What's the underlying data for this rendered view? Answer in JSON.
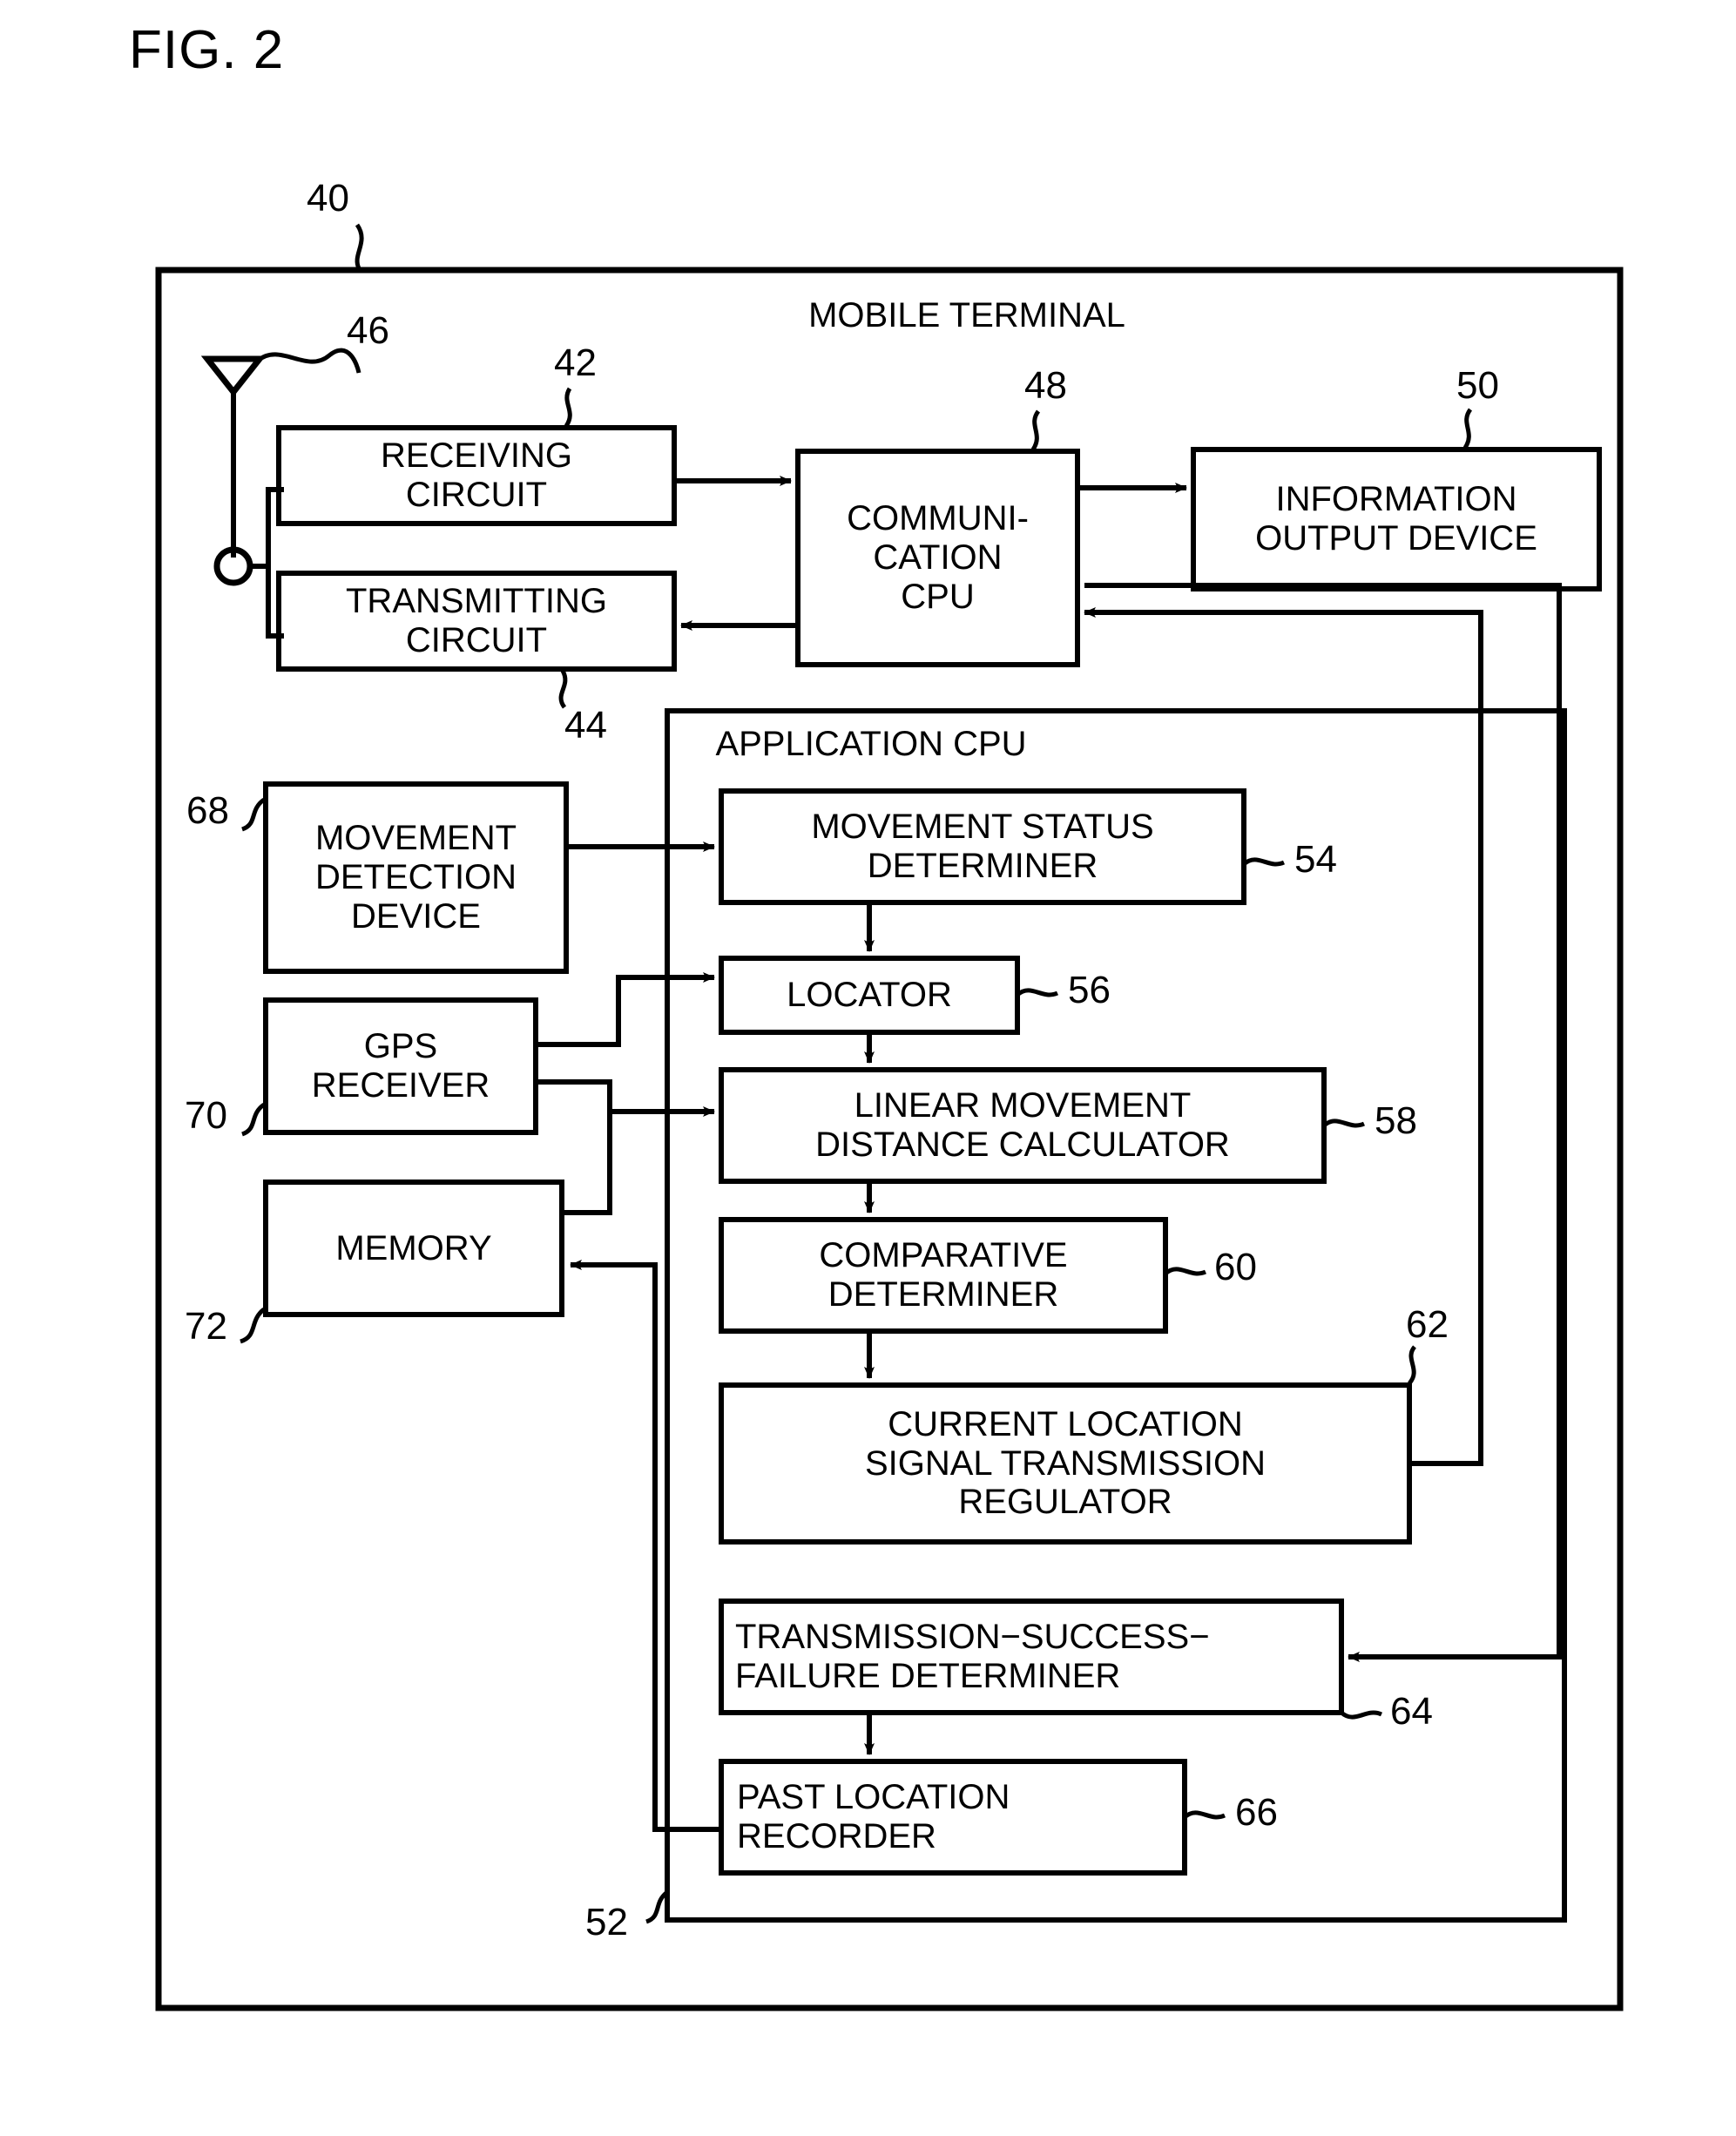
{
  "figure": {
    "title": "FIG. 2",
    "outer_group_title": "MOBILE TERMINAL",
    "outer_group_ref": "40",
    "inner_group_title": "APPLICATION CPU",
    "inner_group_ref": "52",
    "antenna_ref": "46"
  },
  "blocks": {
    "receiving_circuit": {
      "label": "RECEIVING\nCIRCUIT",
      "ref": "42"
    },
    "transmitting_circuit": {
      "label": "TRANSMITTING\nCIRCUIT",
      "ref": "44"
    },
    "communication_cpu": {
      "label": "COMMUNI-\nCATION\nCPU",
      "ref": "48"
    },
    "information_output_device": {
      "label": "INFORMATION\nOUTPUT DEVICE",
      "ref": "50"
    },
    "movement_detection_device": {
      "label": "MOVEMENT\nDETECTION\nDEVICE",
      "ref": "68"
    },
    "gps_receiver": {
      "label": "GPS\nRECEIVER",
      "ref": "70"
    },
    "memory": {
      "label": "MEMORY",
      "ref": "72"
    },
    "movement_status_determiner": {
      "label": "MOVEMENT STATUS\nDETERMINER",
      "ref": "54"
    },
    "locator": {
      "label": "LOCATOR",
      "ref": "56"
    },
    "linear_movement_distance_calculator": {
      "label": "LINEAR MOVEMENT\nDISTANCE CALCULATOR",
      "ref": "58"
    },
    "comparative_determiner": {
      "label": "COMPARATIVE\nDETERMINER",
      "ref": "60"
    },
    "current_location_signal_transmission_regulator": {
      "label": "CURRENT LOCATION\nSIGNAL TRANSMISSION\nREGULATOR",
      "ref": "62"
    },
    "transmission_success_failure_determiner": {
      "label": "TRANSMISSION−SUCCESS−\nFAILURE DETERMINER",
      "ref": "64"
    },
    "past_location_recorder": {
      "label": "PAST LOCATION\nRECORDER",
      "ref": "66"
    }
  },
  "colors": {
    "stroke": "#000000",
    "background": "#ffffff"
  }
}
